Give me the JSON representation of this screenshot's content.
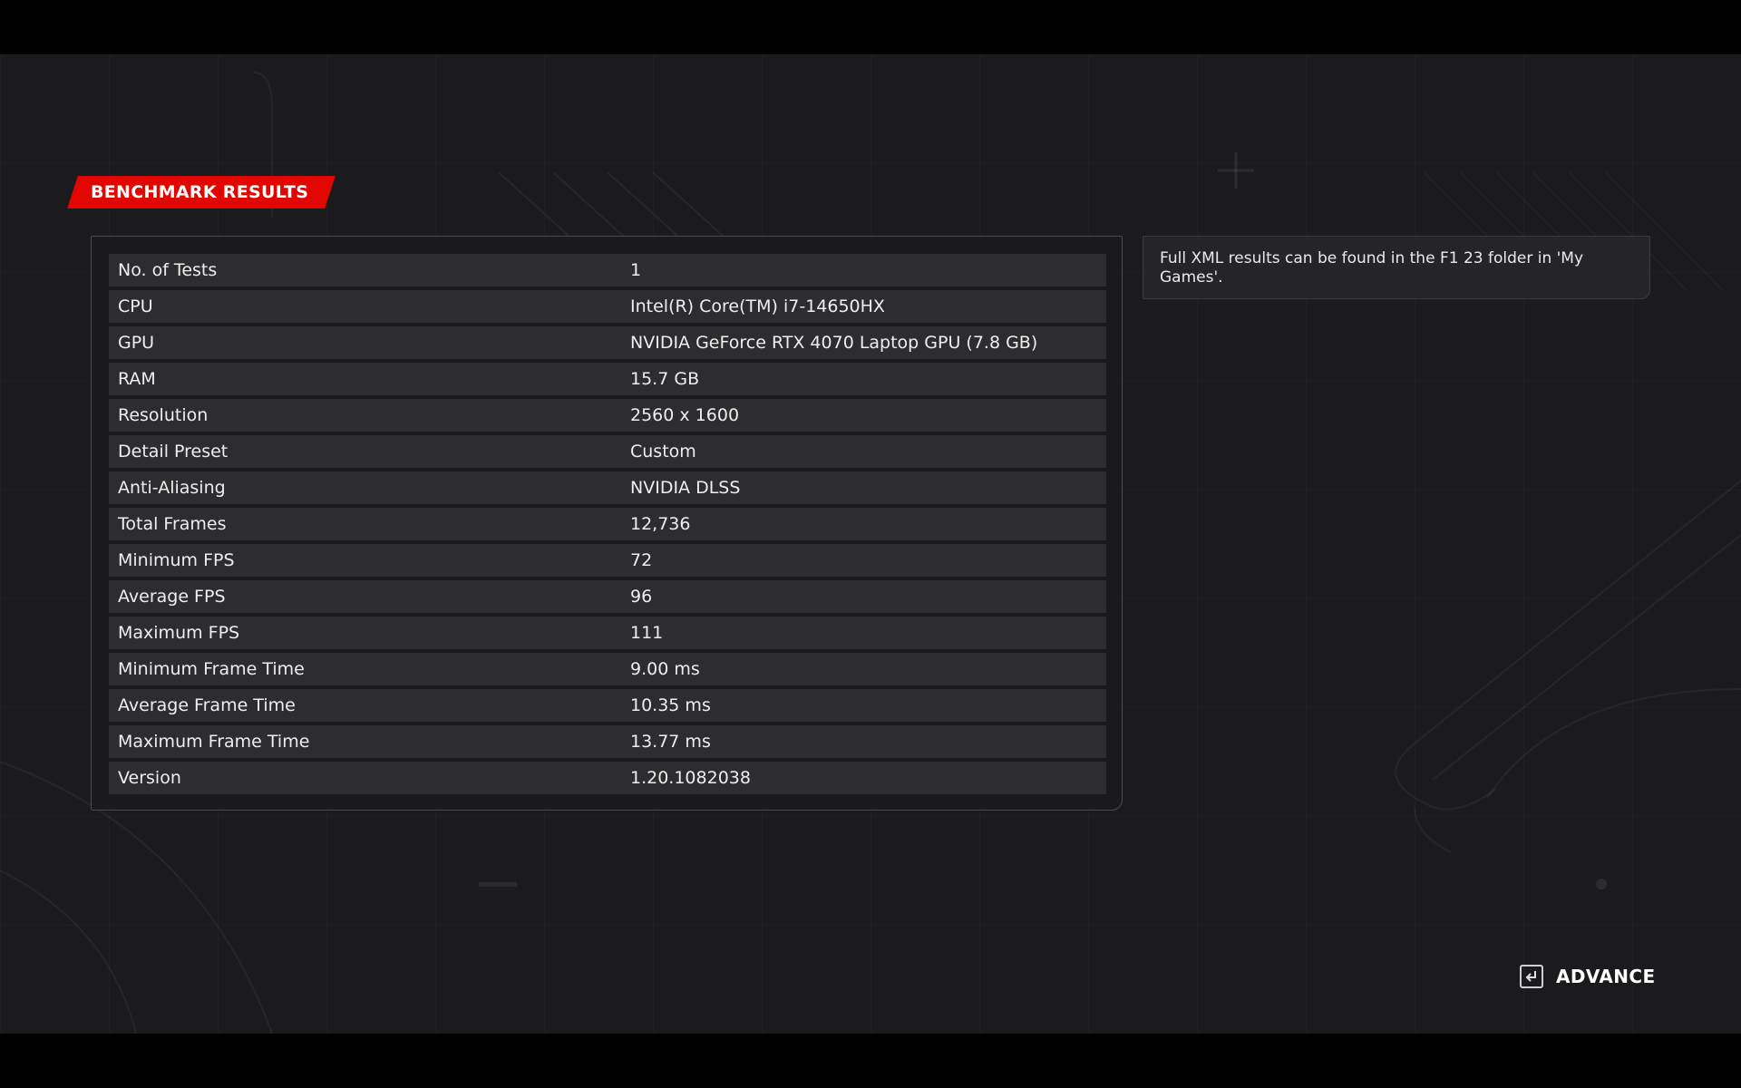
{
  "header": {
    "title": "BENCHMARK RESULTS"
  },
  "results": [
    {
      "label": "No. of Tests",
      "value": "1"
    },
    {
      "label": "CPU",
      "value": "Intel(R) Core(TM) i7-14650HX"
    },
    {
      "label": "GPU",
      "value": "NVIDIA GeForce RTX 4070 Laptop GPU (7.8 GB)"
    },
    {
      "label": "RAM",
      "value": "15.7 GB"
    },
    {
      "label": "Resolution",
      "value": "2560 x 1600"
    },
    {
      "label": "Detail Preset",
      "value": "Custom"
    },
    {
      "label": "Anti-Aliasing",
      "value": "NVIDIA DLSS"
    },
    {
      "label": "Total Frames",
      "value": "12,736"
    },
    {
      "label": "Minimum FPS",
      "value": "72"
    },
    {
      "label": "Average FPS",
      "value": "96"
    },
    {
      "label": "Maximum FPS",
      "value": "111"
    },
    {
      "label": "Minimum Frame Time",
      "value": "9.00 ms"
    },
    {
      "label": "Average Frame Time",
      "value": "10.35 ms"
    },
    {
      "label": "Maximum Frame Time",
      "value": "13.77 ms"
    },
    {
      "label": "Version",
      "value": "1.20.1082038"
    }
  ],
  "info": {
    "text": "Full XML results can be found in the F1 23 folder in 'My Games'."
  },
  "footer": {
    "advance_label": "ADVANCE",
    "advance_icon": "enter-key-icon"
  },
  "colors": {
    "accent": "#e10600",
    "background": "#1b1b1d",
    "row": "#2d2d30"
  }
}
